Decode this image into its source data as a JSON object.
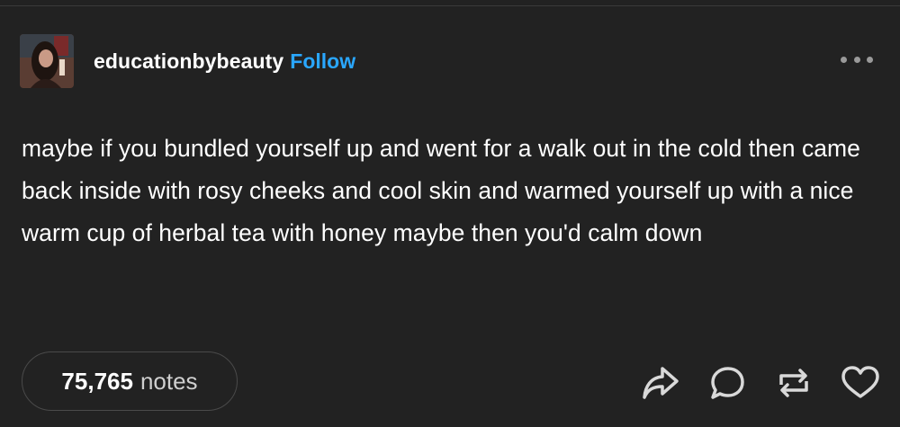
{
  "post": {
    "blog_name": "educationbybeauty",
    "follow_label": "Follow",
    "body": "maybe if you bundled yourself up and went for a walk out in the cold then came back inside with rosy cheeks and cool skin and warmed yourself up with a nice warm cup of herbal tea with honey maybe then you'd calm down",
    "notes_count": "75,765",
    "notes_label": "notes"
  },
  "colors": {
    "background": "#222222",
    "text": "#ffffff",
    "accent": "#2aa7ff",
    "icon": "#d9d9d9"
  },
  "icons": {
    "more": "more-dots-icon",
    "share": "share-arrow-icon",
    "reply": "reply-bubble-icon",
    "reblog": "reblog-icon",
    "like": "heart-icon"
  }
}
